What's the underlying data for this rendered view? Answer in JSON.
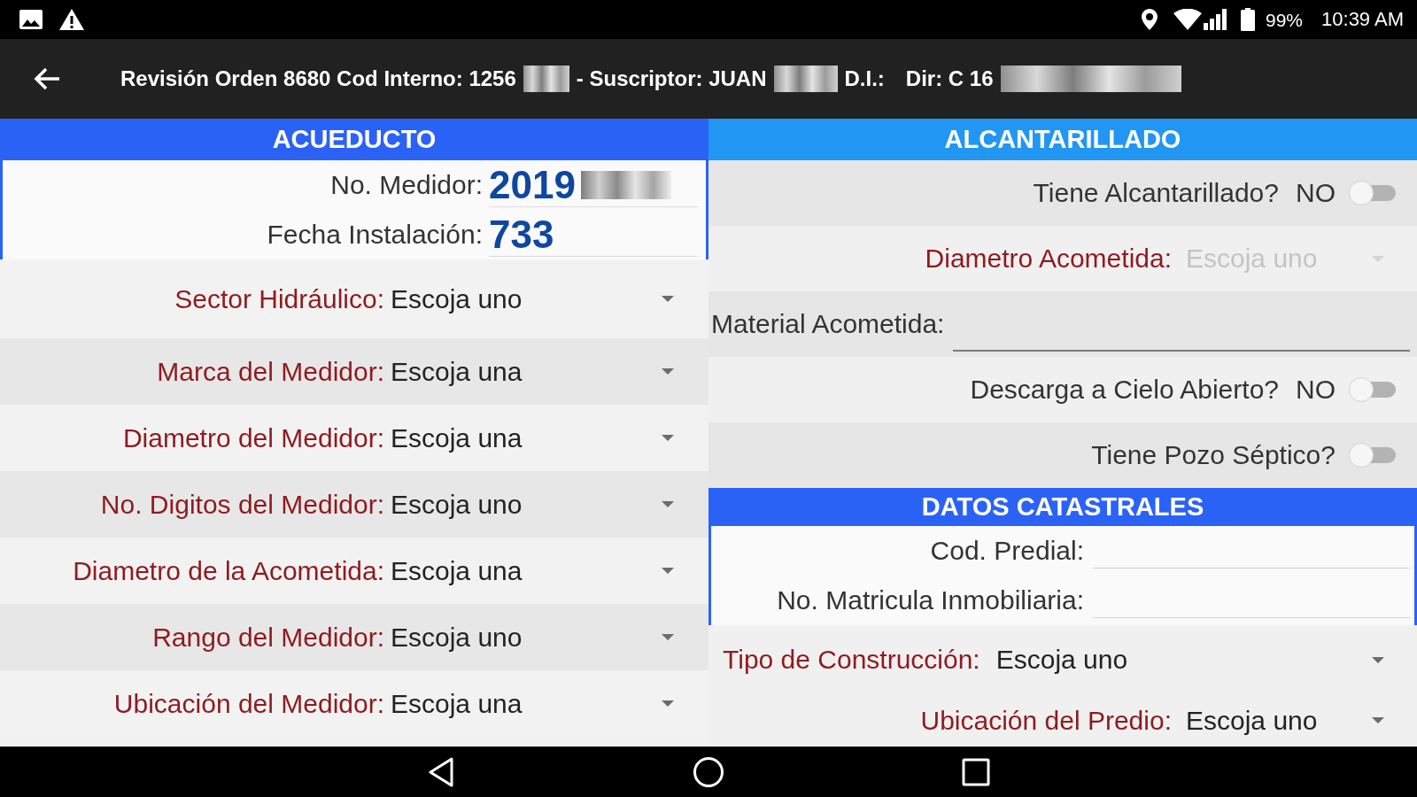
{
  "status_bar": {
    "battery": "99%",
    "time": "10:39 AM"
  },
  "app_bar": {
    "title_parts": [
      {
        "kind": "text",
        "text": "Revisión Orden 8680 Cod Interno: 1256"
      },
      {
        "kind": "redacted"
      },
      {
        "kind": "text",
        "text": "- Suscriptor: JUAN"
      },
      {
        "kind": "redacted"
      },
      {
        "kind": "text",
        "text": "D.I.:"
      },
      {
        "kind": "text",
        "text": "Dir: C 16"
      },
      {
        "kind": "redacted"
      }
    ]
  },
  "left": {
    "header": "ACUEDUCTO",
    "card_fields": [
      {
        "label": "No. Medidor:",
        "value": "2019",
        "redacted": true
      },
      {
        "label": "Fecha Instalación:",
        "value": "733",
        "redacted": false
      }
    ],
    "rows": [
      {
        "label": "Sector Hidráulico:",
        "value": "Escoja uno",
        "required": true,
        "disabled": false
      },
      {
        "label": "Marca del Medidor:",
        "value": "Escoja una",
        "required": true,
        "disabled": false
      },
      {
        "label": "Diametro del Medidor:",
        "value": "Escoja una",
        "required": true,
        "disabled": false
      },
      {
        "label": "No. Digitos del Medidor:",
        "value": "Escoja uno",
        "required": true,
        "disabled": false
      },
      {
        "label": "Diametro de la Acometida:",
        "value": "Escoja una",
        "required": true,
        "disabled": false
      },
      {
        "label": "Rango del Medidor:",
        "value": "Escoja uno",
        "required": true,
        "disabled": false
      },
      {
        "label": "Ubicación del Medidor:",
        "value": "Escoja una",
        "required": true,
        "disabled": false
      }
    ]
  },
  "right": {
    "header": "ALCANTARILLADO",
    "rows": [
      {
        "kind": "switch",
        "label": "Tiene Alcantarillado?",
        "state_text": "NO",
        "on": false,
        "required": false
      },
      {
        "kind": "dropdown",
        "label": "Diametro Acometida:",
        "value": "Escoja uno",
        "required": true,
        "disabled": true
      },
      {
        "kind": "text_field",
        "label": "Material Acometida:",
        "required": false
      },
      {
        "kind": "switch",
        "label": "Descarga a Cielo Abierto?",
        "state_text": "NO",
        "on": false,
        "required": false
      },
      {
        "kind": "switch",
        "label": "Tiene Pozo Séptico?",
        "on": false,
        "required": false
      }
    ],
    "catastral": {
      "header": "DATOS CATASTRALES",
      "card_fields": [
        {
          "label": "Cod. Predial:"
        },
        {
          "label": "No. Matricula Inmobiliaria:"
        }
      ]
    },
    "rows_after": [
      {
        "label": "Tipo de Construcción:",
        "value": "Escoja uno",
        "required": true,
        "disabled": false
      },
      {
        "label": "Ubicación del Predio:",
        "value": "Escoja uno",
        "required": true,
        "disabled": false
      }
    ]
  }
}
